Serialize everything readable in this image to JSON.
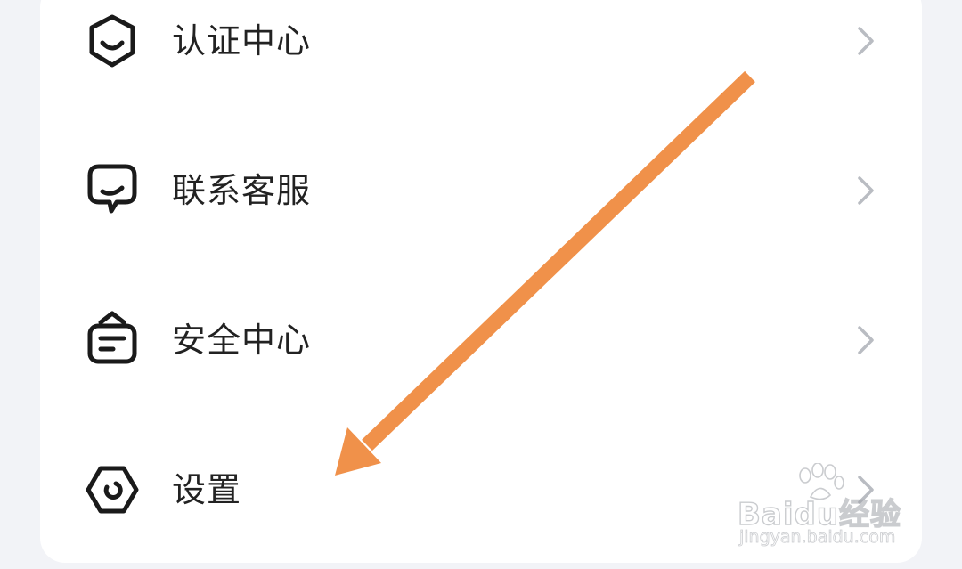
{
  "menu": {
    "items": [
      {
        "label": "认证中心",
        "icon": "verified-shield-icon"
      },
      {
        "label": "联系客服",
        "icon": "customer-service-chat-icon"
      },
      {
        "label": "安全中心",
        "icon": "safety-bag-icon"
      },
      {
        "label": "设置",
        "icon": "settings-hexagon-icon"
      }
    ]
  },
  "annotation": {
    "arrow_color": "#f0914a",
    "arrow_target": "设置"
  },
  "watermark": {
    "brand": "Baidu经验",
    "url": "jingyan.baidu.com"
  },
  "colors": {
    "background": "#f2f3f7",
    "card": "#ffffff",
    "text": "#222222",
    "chevron": "#b9bcc2"
  }
}
